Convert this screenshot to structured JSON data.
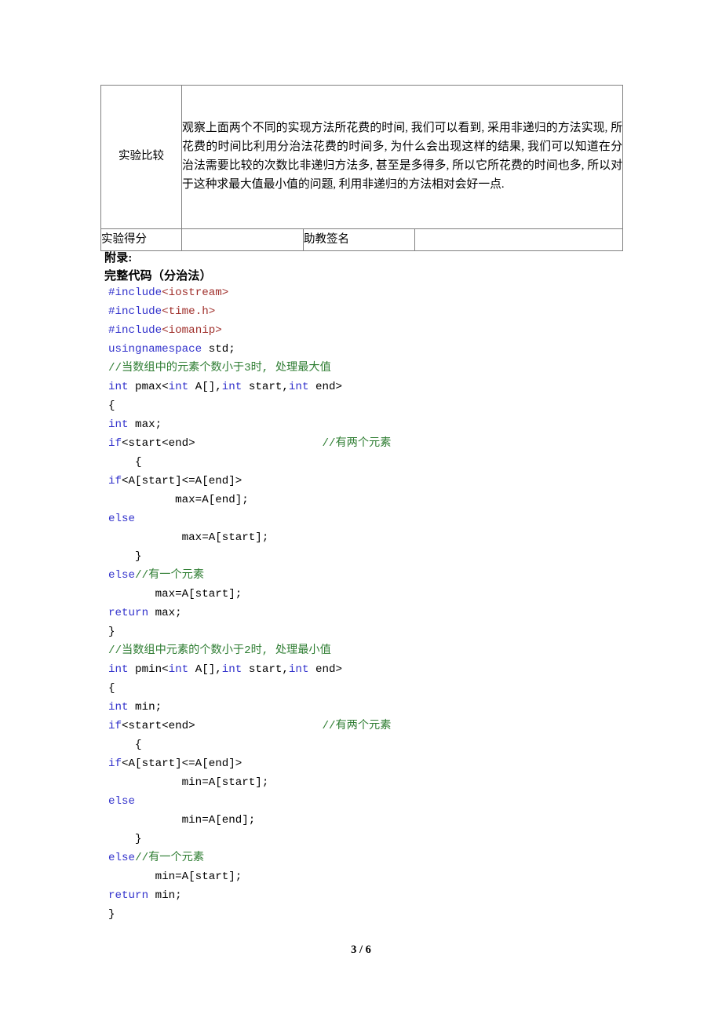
{
  "table": {
    "compare_row": {
      "label": "实验比较",
      "body": "观察上面两个不同的实现方法所花费的时间, 我们可以看到, 采用非递归的方法实现, 所花费的时间比利用分治法花费的时间多, 为什么会出现这样的结果, 我们可以知道在分治法需要比较的次数比非递归方法多, 甚至是多得多, 所以它所花费的时间也多, 所以对于这种求最大值最小值的问题, 利用非递归的方法相对会好一点."
    },
    "score_row": {
      "score_label": "实验得分",
      "score_value": "",
      "sign_label": "助教签名",
      "sign_value": ""
    }
  },
  "appendix": {
    "title": "附录:",
    "subtitle": "完整代码（分治法）"
  },
  "code": {
    "lines": [
      [
        {
          "t": "#include",
          "s": "k"
        },
        {
          "t": "<iostream>",
          "s": "inc"
        }
      ],
      [
        {
          "t": "#include",
          "s": "k"
        },
        {
          "t": "<time.h>",
          "s": "inc"
        }
      ],
      [
        {
          "t": "#include",
          "s": "k"
        },
        {
          "t": "<iomanip>",
          "s": "inc"
        }
      ],
      [
        {
          "t": "usingnamespace",
          "s": "k"
        },
        {
          "t": " std;",
          "s": "p"
        }
      ],
      [
        {
          "t": "//当数组中的元素个数小于3时, 处理最大值",
          "s": "c"
        }
      ],
      [
        {
          "t": "int",
          "s": "k"
        },
        {
          "t": " pmax<",
          "s": "p"
        },
        {
          "t": "int",
          "s": "k"
        },
        {
          "t": " A[],",
          "s": "p"
        },
        {
          "t": "int",
          "s": "k"
        },
        {
          "t": " start,",
          "s": "p"
        },
        {
          "t": "int",
          "s": "k"
        },
        {
          "t": " end>",
          "s": "p"
        }
      ],
      [
        {
          "t": "{",
          "s": "p"
        }
      ],
      [
        {
          "t": "int",
          "s": "k"
        },
        {
          "t": " max;",
          "s": "p"
        }
      ],
      [
        {
          "t": "if",
          "s": "k"
        },
        {
          "t": "<start<end>",
          "s": "p"
        },
        {
          "t": "                   ",
          "s": "p"
        },
        {
          "t": "//有两个元素",
          "s": "c"
        }
      ],
      [
        {
          "t": "    {",
          "s": "p"
        }
      ],
      [
        {
          "t": "if",
          "s": "k"
        },
        {
          "t": "<A[start]<=A[end]>",
          "s": "p"
        }
      ],
      [
        {
          "t": "          max=A[end];",
          "s": "p"
        }
      ],
      [
        {
          "t": "else",
          "s": "k"
        }
      ],
      [
        {
          "t": "           max=A[start];",
          "s": "p"
        }
      ],
      [
        {
          "t": "    }",
          "s": "p"
        }
      ],
      [
        {
          "t": "else",
          "s": "k"
        },
        {
          "t": "//有一个元素",
          "s": "c"
        }
      ],
      [
        {
          "t": "       max=A[start];",
          "s": "p"
        }
      ],
      [
        {
          "t": "return",
          "s": "k"
        },
        {
          "t": " max;",
          "s": "p"
        }
      ],
      [
        {
          "t": "}",
          "s": "p"
        }
      ],
      [
        {
          "t": "//当数组中元素的个数小于2时, 处理最小值",
          "s": "c"
        }
      ],
      [
        {
          "t": "int",
          "s": "k"
        },
        {
          "t": " pmin<",
          "s": "p"
        },
        {
          "t": "int",
          "s": "k"
        },
        {
          "t": " A[],",
          "s": "p"
        },
        {
          "t": "int",
          "s": "k"
        },
        {
          "t": " start,",
          "s": "p"
        },
        {
          "t": "int",
          "s": "k"
        },
        {
          "t": " end>",
          "s": "p"
        }
      ],
      [
        {
          "t": "{",
          "s": "p"
        }
      ],
      [
        {
          "t": "int",
          "s": "k"
        },
        {
          "t": " min;",
          "s": "p"
        }
      ],
      [
        {
          "t": "if",
          "s": "k"
        },
        {
          "t": "<start<end>",
          "s": "p"
        },
        {
          "t": "                   ",
          "s": "p"
        },
        {
          "t": "//有两个元素",
          "s": "c"
        }
      ],
      [
        {
          "t": "    {",
          "s": "p"
        }
      ],
      [
        {
          "t": "if",
          "s": "k"
        },
        {
          "t": "<A[start]<=A[end]>",
          "s": "p"
        }
      ],
      [
        {
          "t": "           min=A[start];",
          "s": "p"
        }
      ],
      [
        {
          "t": "else",
          "s": "k"
        }
      ],
      [
        {
          "t": "           min=A[end];",
          "s": "p"
        }
      ],
      [
        {
          "t": "    }",
          "s": "p"
        }
      ],
      [
        {
          "t": "else",
          "s": "k"
        },
        {
          "t": "//有一个元素",
          "s": "c"
        }
      ],
      [
        {
          "t": "       min=A[start];",
          "s": "p"
        }
      ],
      [
        {
          "t": "return",
          "s": "k"
        },
        {
          "t": " min;",
          "s": "p"
        }
      ],
      [
        {
          "t": "}",
          "s": "p"
        }
      ]
    ]
  },
  "footer": {
    "page_number": "3 / 6"
  },
  "colors": {
    "keyword": "#3333CC",
    "include": "#A0302C",
    "comment": "#2E7D32",
    "plain": "#000000",
    "table_border": "#808080"
  }
}
